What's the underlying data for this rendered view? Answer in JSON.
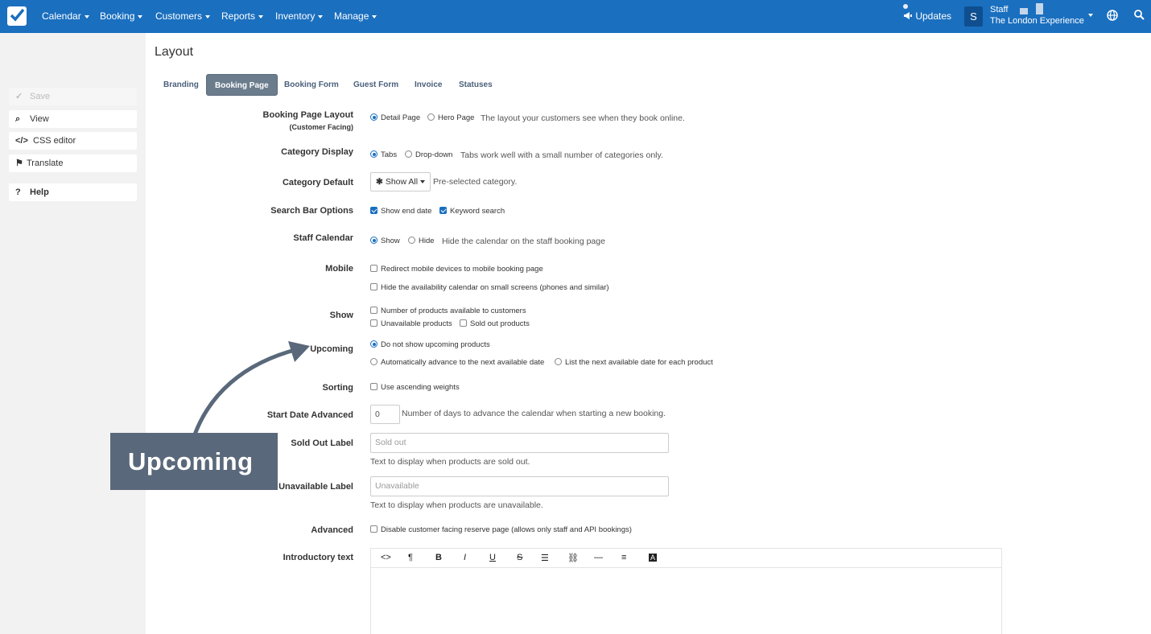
{
  "nav": {
    "items": [
      "Calendar",
      "Booking",
      "Customers",
      "Reports",
      "Inventory",
      "Manage"
    ],
    "updates_label": "Updates",
    "avatar_letter": "S",
    "staff_name": "Staff",
    "org_name": "The London Experience",
    "icons": [
      "check-logo-icon",
      "megaphone-icon",
      "globe-icon",
      "search-icon"
    ]
  },
  "sidebar": {
    "save": "Save",
    "view": "View",
    "css_editor": "CSS editor",
    "translate": "Translate",
    "help": "Help"
  },
  "page": {
    "title": "Layout"
  },
  "tabs": [
    "Branding",
    "Booking Page",
    "Booking Form",
    "Guest Form",
    "Invoice",
    "Statuses"
  ],
  "active_tab": "Booking Page",
  "form": {
    "layout": {
      "label": "Booking Page Layout",
      "sublabel": "(Customer Facing)",
      "opt1": "Detail Page",
      "opt2": "Hero Page",
      "help": "The layout your customers see when they book online."
    },
    "category_display": {
      "label": "Category Display",
      "opt1": "Tabs",
      "opt2": "Drop-down",
      "help": "Tabs work well with a small number of categories only."
    },
    "category_default": {
      "label": "Category Default",
      "value": "Show All",
      "help": "Pre-selected category."
    },
    "search_bar": {
      "label": "Search Bar Options",
      "opt1": "Show end date",
      "opt2": "Keyword search"
    },
    "staff_calendar": {
      "label": "Staff Calendar",
      "opt1": "Show",
      "opt2": "Hide",
      "help": "Hide the calendar on the staff booking page"
    },
    "mobile": {
      "label": "Mobile",
      "opt1": "Redirect mobile devices to mobile booking page",
      "opt2": "Hide the availability calendar on small screens (phones and similar)"
    },
    "show": {
      "label": "Show",
      "opt1": "Number of products available to customers",
      "opt2": "Unavailable products",
      "opt3": "Sold out products"
    },
    "upcoming": {
      "label": "Upcoming",
      "opt1": "Do not show upcoming products",
      "opt2": "Automatically advance to the next available date",
      "opt3": "List the next available date for each product"
    },
    "sorting": {
      "label": "Sorting",
      "opt1": "Use ascending weights"
    },
    "start_date": {
      "label": "Start Date Advanced",
      "value": "0",
      "help": "Number of days to advance the calendar when starting a new booking."
    },
    "sold_out": {
      "label": "Sold Out Label",
      "placeholder": "Sold out",
      "help": "Text to display when products are sold out."
    },
    "unavailable": {
      "label": "Unavailable Label",
      "placeholder": "Unavailable",
      "help": "Text to display when products are unavailable."
    },
    "advanced": {
      "label": "Advanced",
      "opt1": "Disable customer facing reserve page (allows only staff and API bookings)"
    },
    "intro": {
      "label": "Introductory text"
    }
  },
  "callout": {
    "text": "Upcoming"
  },
  "colors": {
    "nav_bg": "#1a6fbf",
    "active_tab": "#6b7c8d",
    "callout_bg": "#59687a"
  }
}
